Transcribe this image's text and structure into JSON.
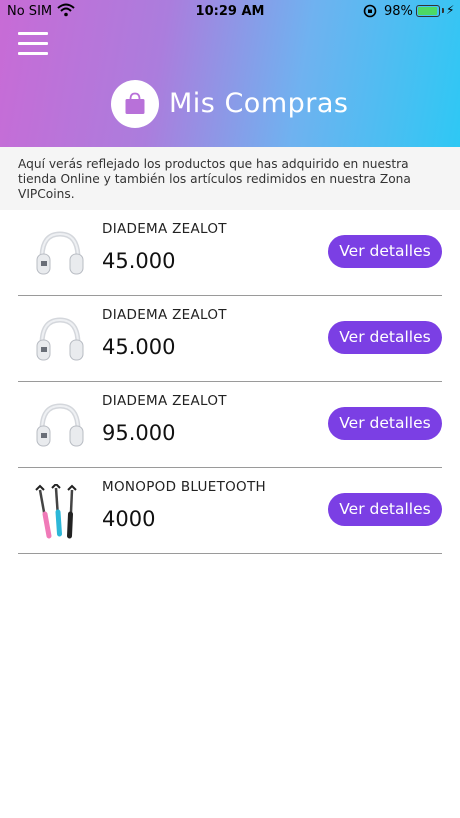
{
  "status_bar": {
    "carrier": "No SIM",
    "time": "10:29 AM",
    "battery": "98%",
    "battery_level": 0.98
  },
  "header": {
    "title": "Mis Compras",
    "gradient_colors": [
      "#c86bd6",
      "#6fb2f0",
      "#2ec8f4"
    ]
  },
  "intro": {
    "text": "Aquí verás reflejado los productos que has adquirido en nuestra tienda Online y también los artículos redimidos en nuestra Zona VIPCoins."
  },
  "accent_color": "#7b3fe4",
  "purchases": [
    {
      "name": "DIADEMA ZEALOT",
      "price": "45.000",
      "button": "Ver detalles",
      "icon": "headphones-icon"
    },
    {
      "name": "DIADEMA ZEALOT",
      "price": "45.000",
      "button": "Ver detalles",
      "icon": "headphones-icon"
    },
    {
      "name": "DIADEMA ZEALOT",
      "price": "95.000",
      "button": "Ver detalles",
      "icon": "headphones-icon"
    },
    {
      "name": "MONOPOD BLUETOOTH",
      "price": "4000",
      "button": "Ver detalles",
      "icon": "selfie-stick-icon"
    }
  ]
}
